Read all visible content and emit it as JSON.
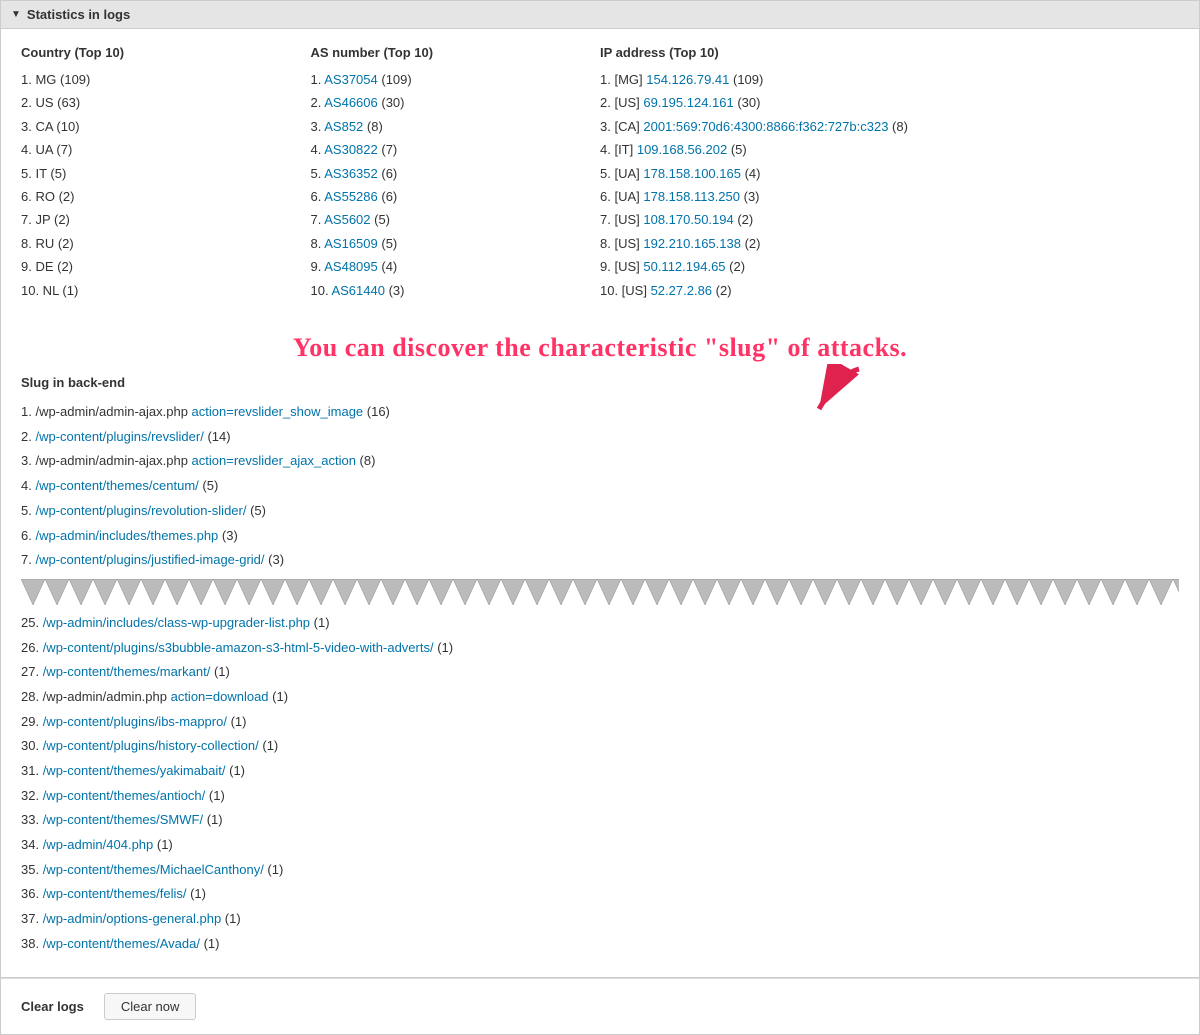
{
  "section": {
    "title": "Statistics in logs",
    "arrow_label": "▼"
  },
  "stats": {
    "country_header": "Country (Top 10)",
    "as_header": "AS number (Top 10)",
    "ip_header": "IP address (Top 10)",
    "countries": [
      {
        "rank": 1,
        "code": "MG",
        "count": 109
      },
      {
        "rank": 2,
        "code": "US",
        "count": 63
      },
      {
        "rank": 3,
        "code": "CA",
        "count": 10
      },
      {
        "rank": 4,
        "code": "UA",
        "count": 7
      },
      {
        "rank": 5,
        "code": "IT",
        "count": 5
      },
      {
        "rank": 6,
        "code": "RO",
        "count": 2
      },
      {
        "rank": 7,
        "code": "JP",
        "count": 2
      },
      {
        "rank": 8,
        "code": "RU",
        "count": 2
      },
      {
        "rank": 9,
        "code": "DE",
        "count": 2
      },
      {
        "rank": 10,
        "code": "NL",
        "count": 1
      }
    ],
    "as_numbers": [
      {
        "rank": 1,
        "as": "AS37054",
        "count": 109
      },
      {
        "rank": 2,
        "as": "AS46606",
        "count": 30
      },
      {
        "rank": 3,
        "as": "AS852",
        "count": 8
      },
      {
        "rank": 4,
        "as": "AS30822",
        "count": 7
      },
      {
        "rank": 5,
        "as": "AS36352",
        "count": 6
      },
      {
        "rank": 6,
        "as": "AS55286",
        "count": 6
      },
      {
        "rank": 7,
        "as": "AS5602",
        "count": 5
      },
      {
        "rank": 8,
        "as": "AS16509",
        "count": 5
      },
      {
        "rank": 9,
        "as": "AS48095",
        "count": 4
      },
      {
        "rank": 10,
        "as": "AS61440",
        "count": 3
      }
    ],
    "ips": [
      {
        "rank": 1,
        "country": "MG",
        "ip": "154.126.79.41",
        "count": 109
      },
      {
        "rank": 2,
        "country": "US",
        "ip": "69.195.124.161",
        "count": 30
      },
      {
        "rank": 3,
        "country": "CA",
        "ip": "2001:569:70d6:4300:8866:f362:727b:c323",
        "count": 8
      },
      {
        "rank": 4,
        "country": "IT",
        "ip": "109.168.56.202",
        "count": 5
      },
      {
        "rank": 5,
        "country": "UA",
        "ip": "178.158.100.165",
        "count": 4
      },
      {
        "rank": 6,
        "country": "UA",
        "ip": "178.158.113.250",
        "count": 3
      },
      {
        "rank": 7,
        "country": "US",
        "ip": "108.170.50.194",
        "count": 2
      },
      {
        "rank": 8,
        "country": "US",
        "ip": "192.210.165.138",
        "count": 2
      },
      {
        "rank": 9,
        "country": "US",
        "ip": "50.112.194.65",
        "count": 2
      },
      {
        "rank": 10,
        "country": "US",
        "ip": "52.27.2.86",
        "count": 2
      }
    ]
  },
  "annotation": {
    "text": "You can discover the characteristic \"slug\" of attacks."
  },
  "slug_section": {
    "header": "Slug in back-end",
    "items_top": [
      {
        "rank": 1,
        "path": "/wp-admin/admin-ajax.php",
        "extra": "action=revslider_show_image",
        "count": 16
      },
      {
        "rank": 2,
        "path": "/wp-content/plugins/revslider/",
        "extra": "",
        "count": 14
      },
      {
        "rank": 3,
        "path": "/wp-admin/admin-ajax.php",
        "extra": "action=revslider_ajax_action",
        "count": 8
      },
      {
        "rank": 4,
        "path": "/wp-content/themes/centum/",
        "extra": "",
        "count": 5
      },
      {
        "rank": 5,
        "path": "/wp-content/plugins/revolution-slider/",
        "extra": "",
        "count": 5
      },
      {
        "rank": 6,
        "path": "/wp-admin/includes/themes.php",
        "extra": "",
        "count": 3
      },
      {
        "rank": 7,
        "path": "/wp-content/plugins/justified-image-grid/",
        "extra": "",
        "count": 3
      }
    ],
    "items_bottom": [
      {
        "rank": 25,
        "path": "/wp-admin/includes/class-wp-upgrader-list.php",
        "extra": "",
        "count": 1
      },
      {
        "rank": 26,
        "path": "/wp-content/plugins/s3bubble-amazon-s3-html-5-video-with-adverts/",
        "extra": "",
        "count": 1
      },
      {
        "rank": 27,
        "path": "/wp-content/themes/markant/",
        "extra": "",
        "count": 1
      },
      {
        "rank": 28,
        "path": "/wp-admin/admin.php",
        "extra": "action=download",
        "count": 1
      },
      {
        "rank": 29,
        "path": "/wp-content/plugins/ibs-mappro/",
        "extra": "",
        "count": 1
      },
      {
        "rank": 30,
        "path": "/wp-content/plugins/history-collection/",
        "extra": "",
        "count": 1
      },
      {
        "rank": 31,
        "path": "/wp-content/themes/yakimabait/",
        "extra": "",
        "count": 1
      },
      {
        "rank": 32,
        "path": "/wp-content/themes/antioch/",
        "extra": "",
        "count": 1
      },
      {
        "rank": 33,
        "path": "/wp-content/themes/SMWF/",
        "extra": "",
        "count": 1
      },
      {
        "rank": 34,
        "path": "/wp-admin/404.php",
        "extra": "",
        "count": 1
      },
      {
        "rank": 35,
        "path": "/wp-content/themes/MichaelCanthony/",
        "extra": "",
        "count": 1
      },
      {
        "rank": 36,
        "path": "/wp-content/themes/felis/",
        "extra": "",
        "count": 1
      },
      {
        "rank": 37,
        "path": "/wp-admin/options-general.php",
        "extra": "",
        "count": 1
      },
      {
        "rank": 38,
        "path": "/wp-content/themes/Avada/",
        "extra": "",
        "count": 1
      }
    ]
  },
  "footer": {
    "label": "Clear logs",
    "button_label": "Clear now"
  }
}
